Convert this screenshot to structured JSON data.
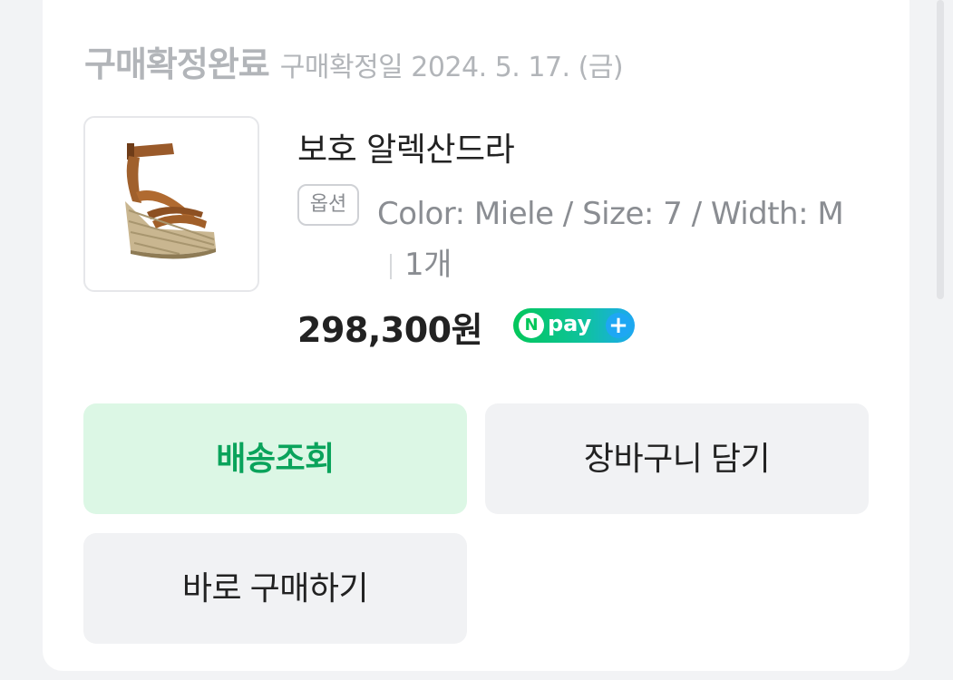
{
  "order": {
    "status": "구매확정완료",
    "confirm_date": "구매확정일 2024. 5. 17. (금)"
  },
  "product": {
    "name": "보호 알렉산드라",
    "option_badge": "옵션",
    "option_text": "Color: Miele / Size: 7 / Width: M",
    "quantity": "1개",
    "price": "298,300원",
    "npay": {
      "n": "N",
      "label": "pay",
      "plus": "+"
    },
    "image_icon": "wedge-sandal-image"
  },
  "buttons": {
    "track": "배송조회",
    "cart": "장바구니 담기",
    "buy_now": "바로 구매하기"
  },
  "colors": {
    "accent_green": "#0aa35b",
    "track_bg": "#dcf7e5",
    "npay_green": "#03c75a"
  }
}
